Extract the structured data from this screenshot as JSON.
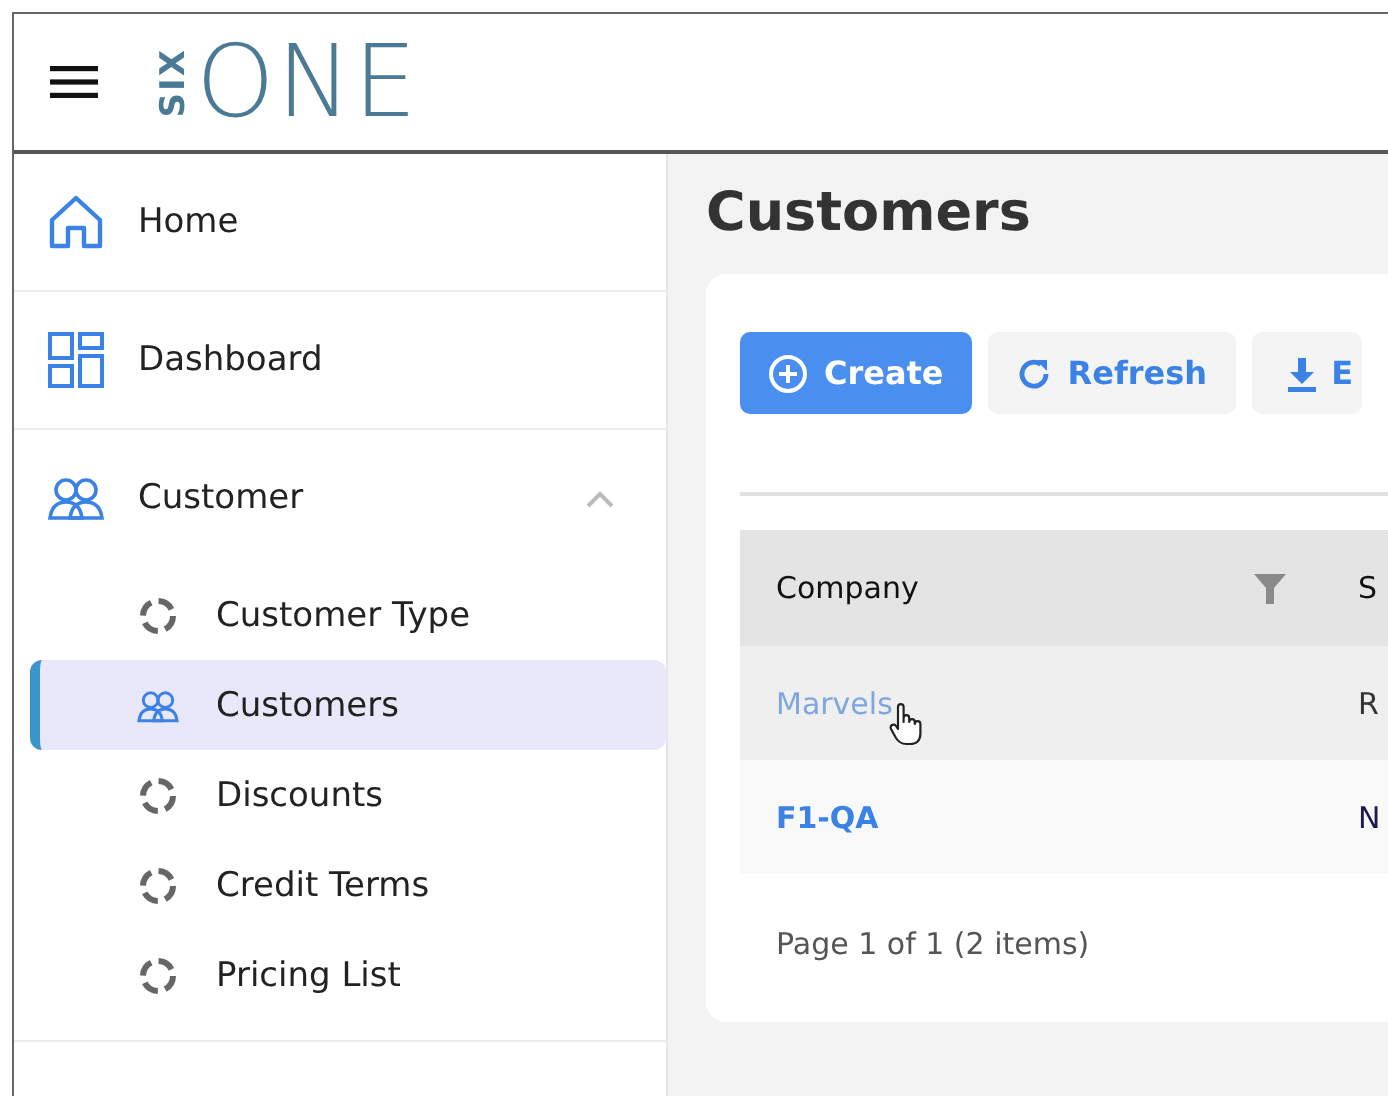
{
  "header": {
    "logo_vertical": "SIX",
    "logo": "ONE"
  },
  "sidebar": {
    "items": [
      {
        "label": "Home",
        "selected": false
      },
      {
        "label": "Dashboard",
        "selected": false
      },
      {
        "label": "Customer",
        "selected": false,
        "expanded": true,
        "children": [
          {
            "label": "Customer Type",
            "selected": false
          },
          {
            "label": "Customers",
            "selected": true
          },
          {
            "label": "Discounts",
            "selected": false
          },
          {
            "label": "Credit Terms",
            "selected": false
          },
          {
            "label": "Pricing List",
            "selected": false
          }
        ]
      }
    ]
  },
  "main": {
    "title": "Customers",
    "toolbar": [
      {
        "label": "Create",
        "kind": "primary"
      },
      {
        "label": "Refresh",
        "kind": "secondary"
      },
      {
        "label": "E",
        "kind": "secondary"
      }
    ],
    "table": {
      "columns": [
        {
          "label": "Company",
          "filter": true
        },
        {
          "label": "S",
          "filter": false
        }
      ],
      "rows": [
        {
          "cells": [
            "Marvels",
            "R"
          ],
          "hovered": true
        },
        {
          "cells": [
            "F1-QA",
            "N"
          ],
          "hovered": false
        }
      ]
    },
    "pager": "Page 1 of 1 (2 items)"
  }
}
